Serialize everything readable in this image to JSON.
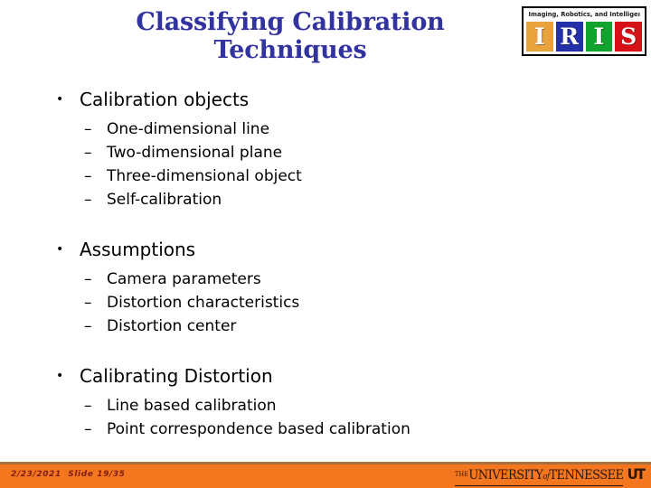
{
  "slide": {
    "title": "Classifying Calibration Techniques",
    "background_color": "#ffffff",
    "title_color": "#3333a0"
  },
  "logo": {
    "name": "iris-logo",
    "tagline": "Imaging, Robotics, and Intelligent Systems",
    "cells": [
      {
        "letter": "I",
        "color": "#e8a33d"
      },
      {
        "letter": "R",
        "color": "#2430a8"
      },
      {
        "letter": "I",
        "color": "#12a32e"
      },
      {
        "letter": "S",
        "color": "#d81118"
      }
    ]
  },
  "content": {
    "bullet_marker": "•",
    "dash_marker": "–",
    "groups": [
      {
        "heading": "Calibration objects",
        "items": [
          "One-dimensional line",
          "Two-dimensional plane",
          "Three-dimensional object",
          "Self-calibration"
        ]
      },
      {
        "heading": "Assumptions",
        "items": [
          "Camera parameters",
          "Distortion characteristics",
          "Distortion center"
        ]
      },
      {
        "heading": "Calibrating Distortion",
        "items": [
          "Line based calibration",
          "Point correspondence based calibration"
        ]
      }
    ]
  },
  "footer": {
    "bar_color": "#f4761f",
    "rule_color": "#a8703c",
    "date_text": "2/23/2021",
    "slide_text": "Slide 19/35",
    "date_slide_combined": "2/23/2021  Slide 19/35",
    "university": {
      "the": "THE",
      "name_part1": "UNIVERSITY",
      "of": "of",
      "name_part2": "TENNESSEE",
      "mark": "UT"
    }
  }
}
